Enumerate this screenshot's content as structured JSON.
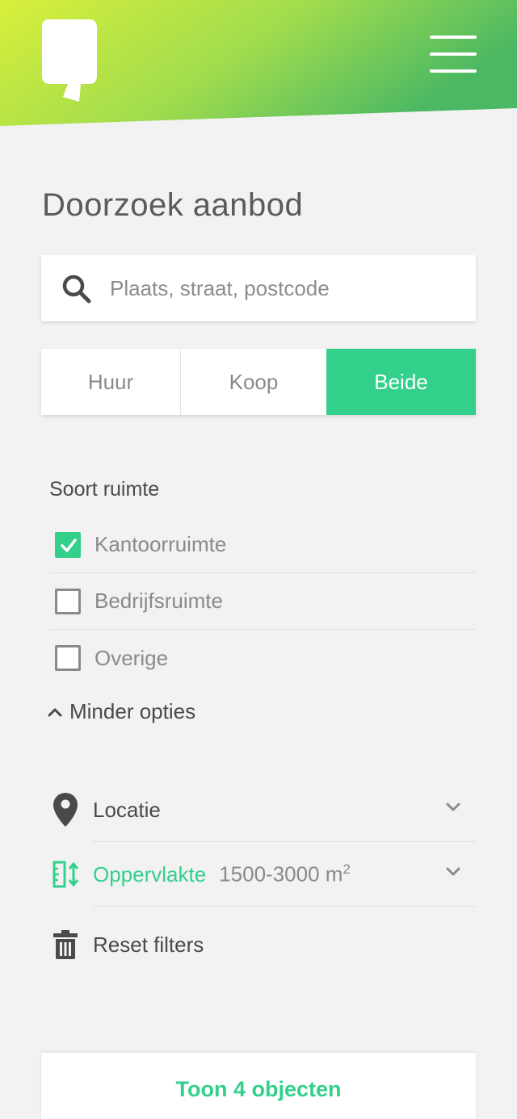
{
  "header": {
    "gradient_start": "#d6ee3a",
    "gradient_end": "#4dba62",
    "logo_icon": "speech-bubble-logo",
    "menu_icon": "hamburger-menu-icon"
  },
  "page_title": "Doorzoek aanbod",
  "search": {
    "placeholder": "Plaats, straat, postcode",
    "value": "",
    "icon": "search-icon"
  },
  "transaction_type": {
    "options": [
      "Huur",
      "Koop",
      "Beide"
    ],
    "selected": "Beide",
    "accent": "#33d08c"
  },
  "space_type": {
    "label": "Soort ruimte",
    "options": [
      {
        "label": "Kantoorruimte",
        "checked": true
      },
      {
        "label": "Bedrijfsruimte",
        "checked": false
      },
      {
        "label": "Overige",
        "checked": false
      }
    ],
    "toggle_label": "Minder opties"
  },
  "filters": {
    "location": {
      "label": "Locatie",
      "icon": "location-pin-icon"
    },
    "area": {
      "label": "Oppervlakte",
      "value": "1500-3000 m",
      "unit_superscript": "2",
      "icon": "area-size-icon"
    },
    "reset": {
      "label": "Reset filters",
      "icon": "trash-icon"
    }
  },
  "show_button": {
    "label": "Toon 4 objecten"
  }
}
